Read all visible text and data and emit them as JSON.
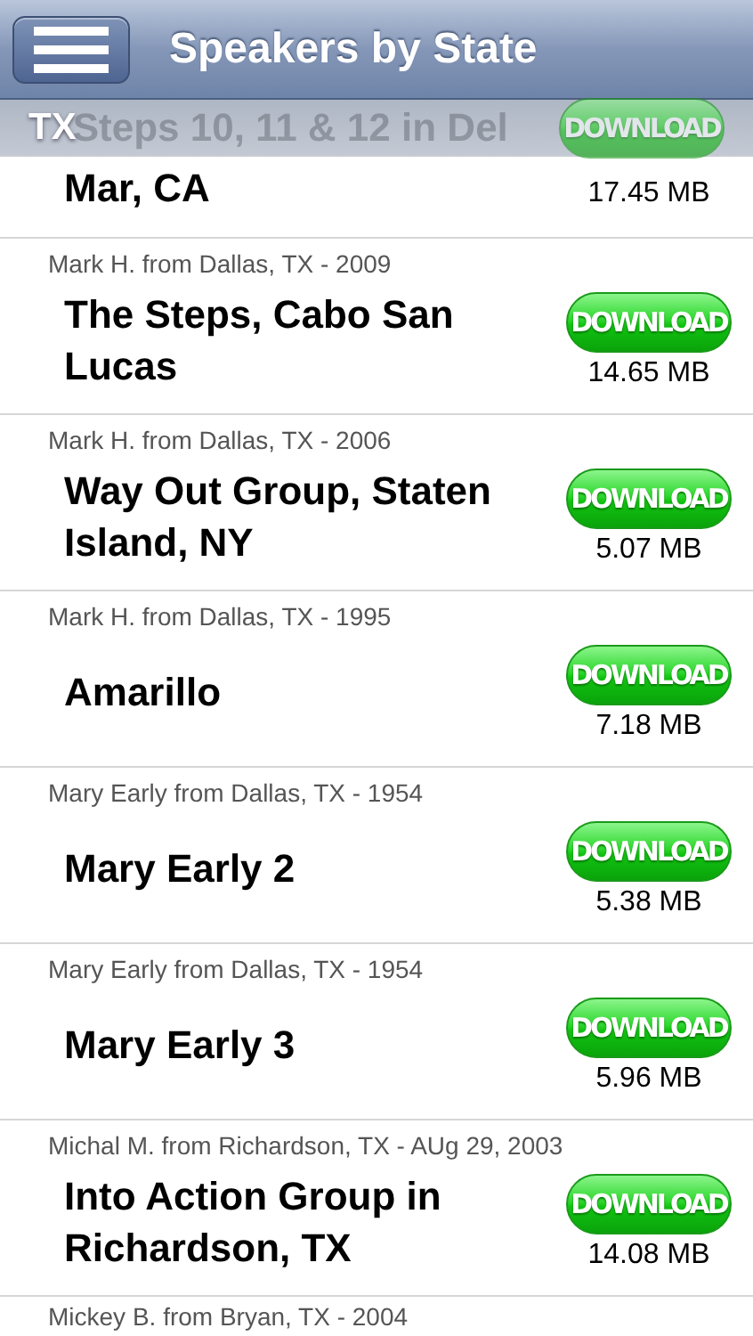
{
  "nav": {
    "title": "Speakers by State"
  },
  "section": {
    "label": "TX"
  },
  "rows": [
    {
      "kind": "partial",
      "hidden_line": "Steps 10, 11 & 12 in Del",
      "title_lines": [
        "Mar, CA"
      ],
      "button": "DOWNLOAD",
      "size": "17.45 MB"
    },
    {
      "kind": "full",
      "subtitle": "Mark H. from Dallas, TX - 2009",
      "title_lines": [
        "The Steps, Cabo San",
        "Lucas"
      ],
      "button": "DOWNLOAD",
      "size": "14.65 MB"
    },
    {
      "kind": "full",
      "subtitle": "Mark H. from Dallas, TX - 2006",
      "title_lines": [
        "Way Out Group, Staten",
        "Island, NY"
      ],
      "button": "DOWNLOAD",
      "size": "5.07 MB"
    },
    {
      "kind": "full",
      "subtitle": "Mark H.  from Dallas, TX - 1995",
      "title_lines": [
        "Amarillo"
      ],
      "button": "DOWNLOAD",
      "size": "7.18 MB"
    },
    {
      "kind": "full",
      "subtitle": "Mary Early from Dallas, TX - 1954",
      "title_lines": [
        "Mary Early 2"
      ],
      "button": "DOWNLOAD",
      "size": "5.38 MB"
    },
    {
      "kind": "full",
      "subtitle": "Mary Early from Dallas, TX - 1954",
      "title_lines": [
        "Mary Early 3"
      ],
      "button": "DOWNLOAD",
      "size": "5.96 MB"
    },
    {
      "kind": "full",
      "subtitle": "Michal M. from Richardson, TX - AUg 29, 2003",
      "title_lines": [
        "Into Action Group in",
        "Richardson, TX"
      ],
      "button": "DOWNLOAD",
      "size": "14.08 MB"
    },
    {
      "kind": "cut",
      "subtitle": "Mickey B. from Bryan, TX - 2004"
    }
  ]
}
